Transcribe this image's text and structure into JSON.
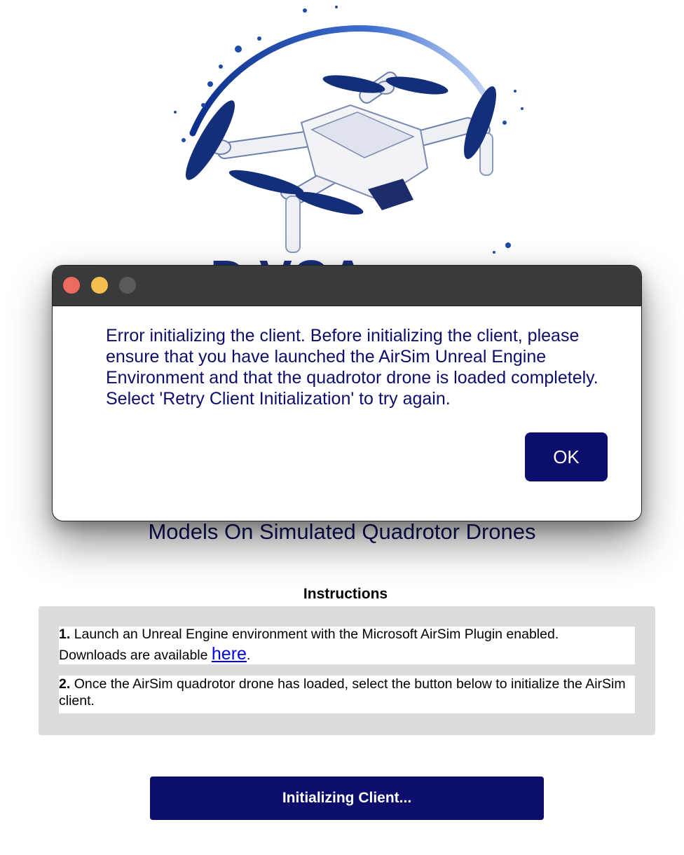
{
  "logo": {
    "icon": "drone-logo",
    "accent": "#1a3f8f"
  },
  "subtitle": "Models On Simulated Quadrotor Drones",
  "instructions": {
    "heading": "Instructions",
    "steps": [
      {
        "num": "1.",
        "text": "Launch an Unreal Engine environment with the Microsoft AirSim Plugin enabled.",
        "text2": "Downloads are available ",
        "link": "here",
        "after": "."
      },
      {
        "num": "2.",
        "text": "Once the AirSim quadrotor drone has loaded, select the button below to initialize the AirSim client."
      }
    ]
  },
  "init_button": "Initializing Client...",
  "dialog": {
    "message": "Error initializing the client. Before initializing the client, please ensure that you have launched the AirSim Unreal Engine Environment and that the quadrotor drone is loaded completely. Select 'Retry Client Initialization' to try again.",
    "ok": "OK"
  },
  "colors": {
    "primary": "#0d0d6e",
    "panel": "#dcdcdc",
    "link": "#0000ee"
  }
}
